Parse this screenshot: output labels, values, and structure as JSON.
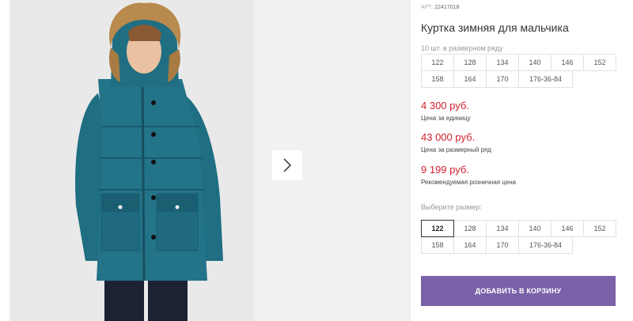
{
  "product": {
    "sku_prefix": "АРТ:",
    "sku": "22417018",
    "title": "Куртка зимняя для мальчика",
    "pack_note": "10 шт. в размерном ряду"
  },
  "pack_sizes": {
    "row1": [
      "122",
      "128",
      "134",
      "140",
      "146",
      "152"
    ],
    "row2": [
      "158",
      "164",
      "170",
      "176-36-84"
    ]
  },
  "prices": {
    "unit_price": "4 300 руб.",
    "unit_label": "Цена за единицу",
    "pack_price": "43 000 руб.",
    "pack_label": "Цена за размерный ряд",
    "retail_price": "9 199 руб.",
    "retail_label": "Рекомендуемая розничная цена"
  },
  "size_selector": {
    "label": "Выберите размер:",
    "selected": "122",
    "row1": [
      "122",
      "128",
      "134",
      "140",
      "146",
      "152"
    ],
    "row2": [
      "158",
      "164",
      "170",
      "176-36-84"
    ]
  },
  "cart": {
    "button_label": "ДОБАВИТЬ В КОРЗИНУ"
  },
  "icons": {
    "next": "chevron-right-icon"
  },
  "colors": {
    "price": "#d0202e",
    "button": "#7a61a8",
    "jacket": "#1e6f84"
  }
}
